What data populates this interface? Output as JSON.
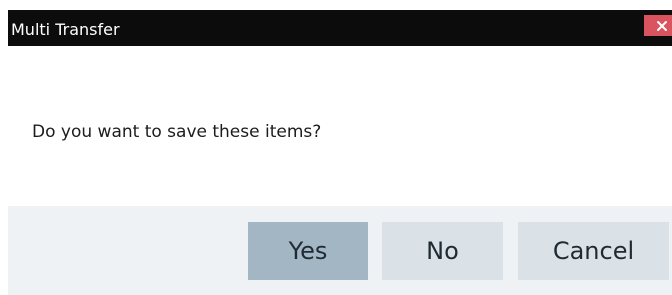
{
  "window": {
    "title": "Multi Transfer",
    "close_icon": "close-icon"
  },
  "message": "Do you want to save these items?",
  "buttons": {
    "yes": "Yes",
    "no": "No",
    "cancel": "Cancel"
  },
  "colors": {
    "titlebar": "#0c0c0c",
    "close_button": "#d9545e",
    "default_button": "#a3b6c4",
    "button": "#dae2e8",
    "footer": "#eff2f4"
  }
}
